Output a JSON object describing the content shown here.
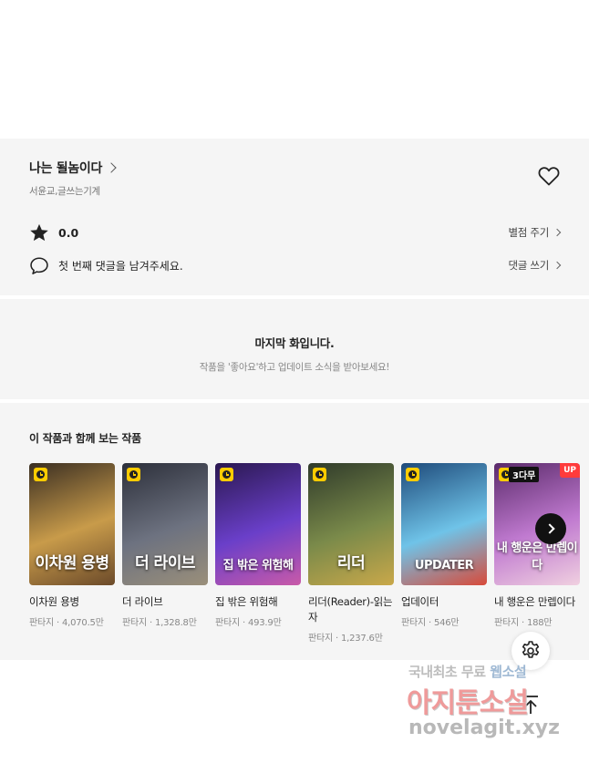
{
  "work": {
    "title": "나는 될놈이다",
    "authors": "서윤교,글쓰는기계",
    "favorite_icon": "heart-outline-icon"
  },
  "rating": {
    "value": "0.0",
    "action": "별점 주기",
    "icon": "star-icon"
  },
  "comments": {
    "text": "첫 번째 댓글을 남겨주세요.",
    "action": "댓글 쓰기",
    "icon": "speech-bubble-icon"
  },
  "last_episode": {
    "title": "마지막 화입니다.",
    "subtitle": "작품을 '좋아요'하고 업데이트 소식을 받아보세요!"
  },
  "recommendations": {
    "heading": "이 작품과 함께 보는 작품",
    "items": [
      {
        "title": "이차원 용병",
        "genre": "판타지",
        "views": "4,070.5만",
        "cover_text": "이차원 용병",
        "colors": [
          "#3a2e22",
          "#c89b4a",
          "#6b4a2a"
        ]
      },
      {
        "title": "더 라이브",
        "genre": "판타지",
        "views": "1,328.8만",
        "cover_text": "더 라이브",
        "colors": [
          "#2c2f3a",
          "#6d7280",
          "#9a8f7a"
        ]
      },
      {
        "title": "집 밖은 위험해",
        "genre": "판타지",
        "views": "493.9만",
        "cover_text": "집 밖은 위험해",
        "colors": [
          "#2a1850",
          "#6a3fc9",
          "#c95aa8"
        ]
      },
      {
        "title": "리더(Reader)-읽는자",
        "genre": "판타지",
        "views": "1,237.6만",
        "cover_text": "리더",
        "colors": [
          "#2f3a2a",
          "#7a8a4a",
          "#c9a84a"
        ]
      },
      {
        "title": "업데이터",
        "genre": "판타지",
        "views": "546만",
        "cover_text": "UPDATER",
        "colors": [
          "#1e4a7a",
          "#6fc3e8",
          "#d84a3a"
        ]
      },
      {
        "title": "내 행운은 만렙이다",
        "genre": "판타지",
        "views": "188만",
        "cover_text": "내 행운은 만렙이다",
        "colors": [
          "#5a2a6a",
          "#c07ad0",
          "#f0d0e0"
        ],
        "badge_left": "3다무",
        "badge_right": "UP"
      }
    ]
  },
  "floating": {
    "next_icon": "chevron-right-icon",
    "settings_icon": "gear-icon",
    "top_icon": "arrow-up-icon"
  },
  "watermark": {
    "line1_a": "국내최초 무료",
    "line1_b": "웹소설",
    "line2": "아지툰소설",
    "line3": "novelagit.xyz"
  },
  "colors": {
    "panel_bg": "#f5f5f5",
    "text_primary": "#222222",
    "text_secondary": "#888888",
    "clock_badge": "#ffcc00",
    "up_badge": "#ff3b3b"
  }
}
